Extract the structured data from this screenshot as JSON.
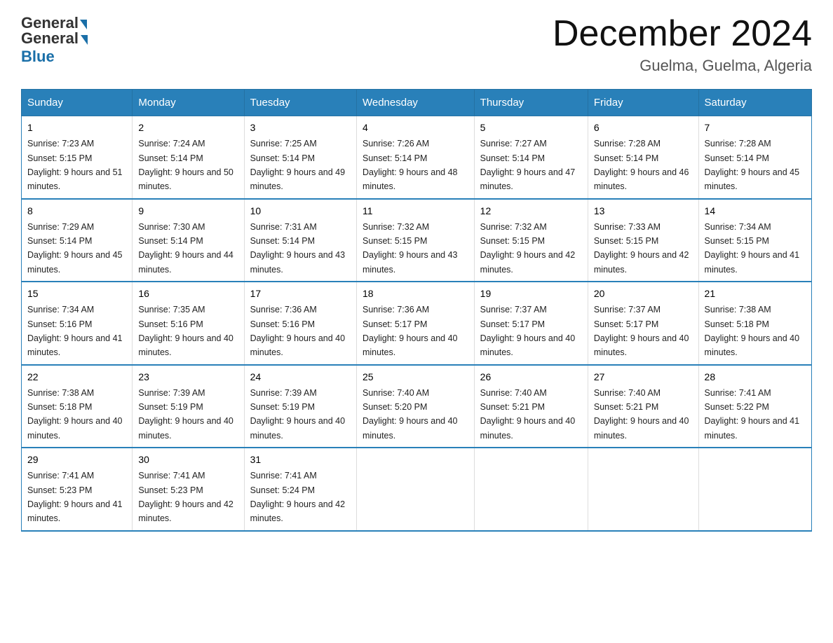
{
  "header": {
    "logo_general": "General",
    "logo_blue": "Blue",
    "month_title": "December 2024",
    "location": "Guelma, Guelma, Algeria"
  },
  "days_of_week": [
    "Sunday",
    "Monday",
    "Tuesday",
    "Wednesday",
    "Thursday",
    "Friday",
    "Saturday"
  ],
  "weeks": [
    [
      {
        "day": "1",
        "sunrise": "7:23 AM",
        "sunset": "5:15 PM",
        "daylight": "9 hours and 51 minutes."
      },
      {
        "day": "2",
        "sunrise": "7:24 AM",
        "sunset": "5:14 PM",
        "daylight": "9 hours and 50 minutes."
      },
      {
        "day": "3",
        "sunrise": "7:25 AM",
        "sunset": "5:14 PM",
        "daylight": "9 hours and 49 minutes."
      },
      {
        "day": "4",
        "sunrise": "7:26 AM",
        "sunset": "5:14 PM",
        "daylight": "9 hours and 48 minutes."
      },
      {
        "day": "5",
        "sunrise": "7:27 AM",
        "sunset": "5:14 PM",
        "daylight": "9 hours and 47 minutes."
      },
      {
        "day": "6",
        "sunrise": "7:28 AM",
        "sunset": "5:14 PM",
        "daylight": "9 hours and 46 minutes."
      },
      {
        "day": "7",
        "sunrise": "7:28 AM",
        "sunset": "5:14 PM",
        "daylight": "9 hours and 45 minutes."
      }
    ],
    [
      {
        "day": "8",
        "sunrise": "7:29 AM",
        "sunset": "5:14 PM",
        "daylight": "9 hours and 45 minutes."
      },
      {
        "day": "9",
        "sunrise": "7:30 AM",
        "sunset": "5:14 PM",
        "daylight": "9 hours and 44 minutes."
      },
      {
        "day": "10",
        "sunrise": "7:31 AM",
        "sunset": "5:14 PM",
        "daylight": "9 hours and 43 minutes."
      },
      {
        "day": "11",
        "sunrise": "7:32 AM",
        "sunset": "5:15 PM",
        "daylight": "9 hours and 43 minutes."
      },
      {
        "day": "12",
        "sunrise": "7:32 AM",
        "sunset": "5:15 PM",
        "daylight": "9 hours and 42 minutes."
      },
      {
        "day": "13",
        "sunrise": "7:33 AM",
        "sunset": "5:15 PM",
        "daylight": "9 hours and 42 minutes."
      },
      {
        "day": "14",
        "sunrise": "7:34 AM",
        "sunset": "5:15 PM",
        "daylight": "9 hours and 41 minutes."
      }
    ],
    [
      {
        "day": "15",
        "sunrise": "7:34 AM",
        "sunset": "5:16 PM",
        "daylight": "9 hours and 41 minutes."
      },
      {
        "day": "16",
        "sunrise": "7:35 AM",
        "sunset": "5:16 PM",
        "daylight": "9 hours and 40 minutes."
      },
      {
        "day": "17",
        "sunrise": "7:36 AM",
        "sunset": "5:16 PM",
        "daylight": "9 hours and 40 minutes."
      },
      {
        "day": "18",
        "sunrise": "7:36 AM",
        "sunset": "5:17 PM",
        "daylight": "9 hours and 40 minutes."
      },
      {
        "day": "19",
        "sunrise": "7:37 AM",
        "sunset": "5:17 PM",
        "daylight": "9 hours and 40 minutes."
      },
      {
        "day": "20",
        "sunrise": "7:37 AM",
        "sunset": "5:17 PM",
        "daylight": "9 hours and 40 minutes."
      },
      {
        "day": "21",
        "sunrise": "7:38 AM",
        "sunset": "5:18 PM",
        "daylight": "9 hours and 40 minutes."
      }
    ],
    [
      {
        "day": "22",
        "sunrise": "7:38 AM",
        "sunset": "5:18 PM",
        "daylight": "9 hours and 40 minutes."
      },
      {
        "day": "23",
        "sunrise": "7:39 AM",
        "sunset": "5:19 PM",
        "daylight": "9 hours and 40 minutes."
      },
      {
        "day": "24",
        "sunrise": "7:39 AM",
        "sunset": "5:19 PM",
        "daylight": "9 hours and 40 minutes."
      },
      {
        "day": "25",
        "sunrise": "7:40 AM",
        "sunset": "5:20 PM",
        "daylight": "9 hours and 40 minutes."
      },
      {
        "day": "26",
        "sunrise": "7:40 AM",
        "sunset": "5:21 PM",
        "daylight": "9 hours and 40 minutes."
      },
      {
        "day": "27",
        "sunrise": "7:40 AM",
        "sunset": "5:21 PM",
        "daylight": "9 hours and 40 minutes."
      },
      {
        "day": "28",
        "sunrise": "7:41 AM",
        "sunset": "5:22 PM",
        "daylight": "9 hours and 41 minutes."
      }
    ],
    [
      {
        "day": "29",
        "sunrise": "7:41 AM",
        "sunset": "5:23 PM",
        "daylight": "9 hours and 41 minutes."
      },
      {
        "day": "30",
        "sunrise": "7:41 AM",
        "sunset": "5:23 PM",
        "daylight": "9 hours and 42 minutes."
      },
      {
        "day": "31",
        "sunrise": "7:41 AM",
        "sunset": "5:24 PM",
        "daylight": "9 hours and 42 minutes."
      },
      null,
      null,
      null,
      null
    ]
  ]
}
